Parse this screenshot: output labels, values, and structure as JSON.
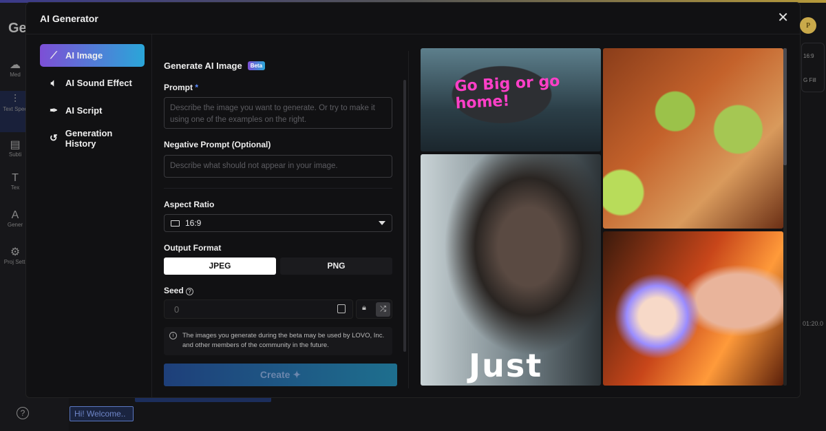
{
  "app": {
    "title_partial": "Ge",
    "sidebar": [
      {
        "icon": "upload-icon",
        "label": "Med"
      },
      {
        "icon": "waveform-icon",
        "label": "Text Spee"
      },
      {
        "icon": "subtitle-icon",
        "label": "Subti"
      },
      {
        "icon": "text-icon",
        "label": "Tex"
      },
      {
        "icon": "ai-icon",
        "label": "Gener"
      },
      {
        "icon": "gear-icon",
        "label": "Proj Setti"
      }
    ],
    "avatar": "P",
    "right_panel": {
      "ratio": "16:9",
      "fill": "G Fill"
    },
    "timeline_time": "01:20.0",
    "clip_text": "Hi! Welcome.."
  },
  "dialog": {
    "title": "AI Generator",
    "nav": [
      {
        "label": "AI Image",
        "icon": "magic-wand-icon",
        "active": true
      },
      {
        "label": "AI Sound Effect",
        "icon": "sound-effect-icon"
      },
      {
        "label": "AI Script",
        "icon": "quill-icon"
      },
      {
        "label": "Generation History",
        "icon": "history-icon"
      }
    ],
    "form": {
      "heading": "Generate AI Image",
      "badge": "Beta",
      "prompt_label": "Prompt",
      "required_mark": "*",
      "prompt_placeholder": "Describe the image you want to generate. Or try to make it using one of the examples on the right.",
      "negative_label": "Negative Prompt (Optional)",
      "negative_placeholder": "Describe what should not appear in your image.",
      "aspect_label": "Aspect Ratio",
      "aspect_value": "16:9",
      "format_label": "Output Format",
      "formats": [
        "JPEG",
        "PNG"
      ],
      "selected_format": "JPEG",
      "seed_label": "Seed",
      "seed_value": "0",
      "note": "The images you generate during the beta may be used by LOVO, Inc. and other members of the community in the future.",
      "create_label": "Create"
    },
    "gallery": [
      {
        "text": "Go Big or go home!"
      },
      {
        "text": "Just"
      },
      {
        "text": ""
      },
      {
        "text": ""
      }
    ],
    "accent_gradient": [
      "#7d4fd6",
      "#2aa6d8"
    ]
  }
}
